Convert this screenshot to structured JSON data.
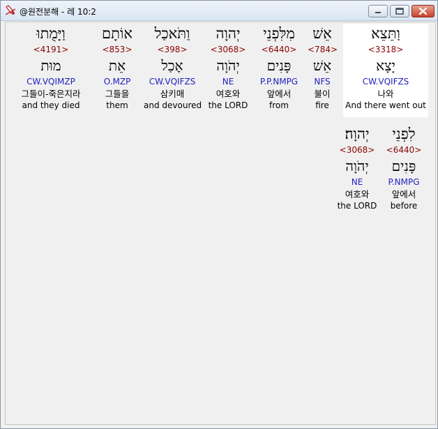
{
  "window": {
    "title": "@원전분해 - 레 10:2"
  },
  "row1": [
    {
      "hebrew": "וַתֵּצֵא",
      "strong": "<3318>",
      "lemma": "יָצָא",
      "morph": "CW.VQIFZS",
      "korean": "나와",
      "english": "And there went out"
    },
    {
      "hebrew": "אֵשׁ",
      "strong": "<784>",
      "lemma": "אֵשׁ",
      "morph": "NFS",
      "korean": "불이",
      "english": "fire"
    },
    {
      "hebrew": "מִלִּפְנֵי",
      "strong": "<6440>",
      "lemma": "פָּנִים",
      "morph": "P.P.NMPG",
      "korean": "앞에서",
      "english": "from"
    },
    {
      "hebrew": "יְהוָה",
      "strong": "<3068>",
      "lemma": "יְהֹוָה",
      "morph": "NE",
      "korean": "여호와",
      "english": "the LORD"
    },
    {
      "hebrew": "וַתֹּאכַל",
      "strong": "<398>",
      "lemma": "אָכַל",
      "morph": "CW.VQIFZS",
      "korean": "삼키매",
      "english": "and devoured"
    },
    {
      "hebrew": "אוֹתָם",
      "strong": "<853>",
      "lemma": "אֵת",
      "morph": "O.MZP",
      "korean": "그들을",
      "english": "them"
    },
    {
      "hebrew": "וַיָּמֻתוּ",
      "strong": "<4191>",
      "lemma": "מוּת",
      "morph": "CW.VQIMZP",
      "korean": "그들이-죽은지라",
      "english": "and they died"
    }
  ],
  "row2": [
    {
      "hebrew": "לִפְנֵי",
      "strong": "<6440>",
      "lemma": "פָּנִים",
      "morph": "P.NMPG",
      "korean": "앞에서",
      "english": "before"
    },
    {
      "hebrew": "יְהוָה׃",
      "strong": "<3068>",
      "lemma": "יְהֹוָה",
      "morph": "NE",
      "korean": "여호와",
      "english": "the LORD"
    }
  ]
}
